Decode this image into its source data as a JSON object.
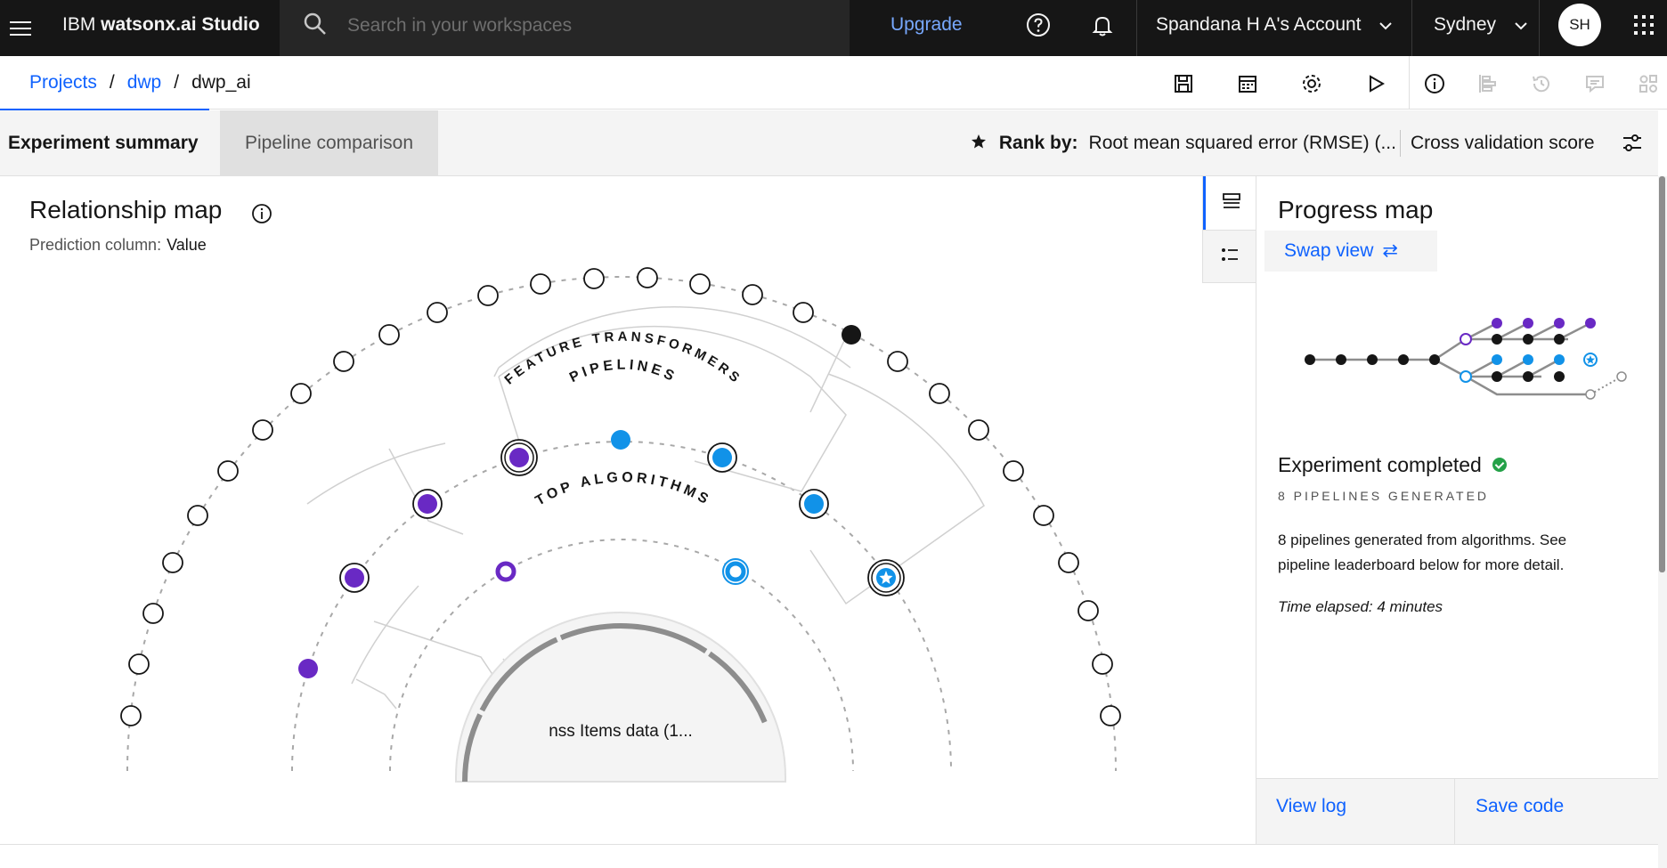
{
  "header": {
    "brand_prefix": "IBM ",
    "brand_name": "watsonx.ai Studio",
    "search_placeholder": "Search in your workspaces",
    "upgrade_label": "Upgrade",
    "account_label": "Spandana H A's Account",
    "region_label": "Sydney",
    "avatar_initials": "SH",
    "icons": [
      "menu-icon",
      "search-icon",
      "help-icon",
      "notification-icon",
      "chevron-down-icon",
      "app-switcher-icon"
    ]
  },
  "breadcrumb": {
    "items": [
      "Projects",
      "dwp",
      "dwp_ai"
    ],
    "separator": "/"
  },
  "toolbar": {
    "icons": [
      "save-icon",
      "calendar-icon",
      "settings-icon",
      "run-icon",
      "info-icon",
      "timeline-icon",
      "history-icon",
      "comment-icon",
      "assets-icon"
    ]
  },
  "tabs": {
    "summary": "Experiment summary",
    "comparison": "Pipeline comparison"
  },
  "rank": {
    "label": "Rank by:",
    "value": "Root mean squared error (RMSE) (...",
    "metric": "Cross validation score"
  },
  "relationship_map": {
    "title": "Relationship map",
    "prediction_label": "Prediction column:",
    "prediction_value": "Value",
    "ring_feature_transformers": "FEATURE TRANSFORMERS",
    "ring_pipelines": "PIPELINES",
    "ring_top_algorithms": "TOP ALGORITHMS",
    "center_label": "nss Items data (1...",
    "colors": {
      "purple": "#6929c4",
      "blue": "#1192e8",
      "black": "#161616",
      "ring": "#8d8d8d"
    }
  },
  "progress_map": {
    "title": "Progress map",
    "swap_label": "Swap view",
    "status_title": "Experiment completed",
    "status_subtitle": "8 PIPELINES GENERATED",
    "description": "8 pipelines generated from algorithms. See pipeline leaderboard below for more detail.",
    "elapsed": "Time elapsed: 4 minutes",
    "view_log": "View log",
    "save_code": "Save code"
  }
}
